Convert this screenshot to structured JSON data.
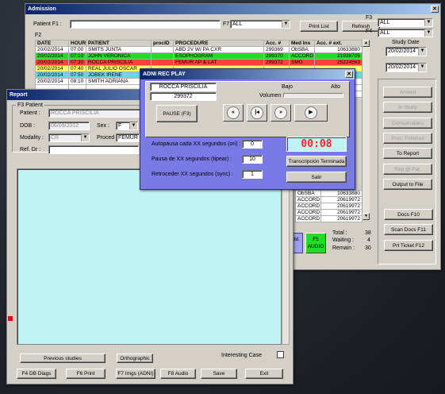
{
  "admission": {
    "title": "Admission",
    "patient_label": "Patient F1 :",
    "f7_label": "F7",
    "f7_value": "ALL",
    "f2_label": "F2",
    "print_list": "Print List",
    "refresh": "Refresh",
    "f3_label": "F3",
    "f3_value": "ALL",
    "f4_label": "F4",
    "f4_value": "ALL",
    "study_date_label": "Study Date",
    "date_from": "20/02/2014",
    "date_to": "20/02/2014",
    "columns": [
      "DATE",
      "HOUR",
      "PATIENT",
      "procID",
      "PROCEDURE",
      "Acc. #",
      "Med Ins",
      "Acc. # ext."
    ],
    "rows": [
      {
        "date": "20/02/2014",
        "hour": "07:00",
        "patient": "SMITS JUNTA",
        "procid": "",
        "procedure": "ABD 2V W/ PA CXR",
        "acc": "299369",
        "medins": "ObSBA",
        "accext": "10633880"
      },
      {
        "date": "20/02/2014",
        "hour": "07:10",
        "patient": "JOHN VERONICA",
        "procid": "",
        "procedure": "ESOPHOGRAM",
        "acc": "299370",
        "medins": "ACCORD",
        "accext": "21938705"
      },
      {
        "date": "20/02/2014",
        "hour": "07:30",
        "patient": "ROCCA PRISCILIA",
        "procid": "",
        "procedure": "FEMUR AP & LAT",
        "acc": "299372",
        "medins": "SMG",
        "accext": "25224563"
      },
      {
        "date": "20/02/2014",
        "hour": "07:40",
        "patient": "REAL JULIO OSCAR",
        "procid": "",
        "procedure": "",
        "acc": "",
        "medins": "",
        "accext": ""
      },
      {
        "date": "20/02/2014",
        "hour": "07:50",
        "patient": "JOBEK IRENE",
        "procid": "",
        "procedure": "",
        "acc": "",
        "medins": "",
        "accext": ""
      },
      {
        "date": "20/02/2014",
        "hour": "08:10",
        "patient": "SMITH ADRIANA",
        "procid": "",
        "procedure": "",
        "acc": "",
        "medins": "",
        "accext": ""
      }
    ],
    "lower_rows": [
      {
        "medins": "ObSBA",
        "accext": "10633880"
      },
      {
        "medins": "ACCORD",
        "accext": "20619972"
      },
      {
        "medins": "ACCORD",
        "accext": "20619972"
      },
      {
        "medins": "ACCORD",
        "accext": "20619972"
      },
      {
        "medins": "ACCORD",
        "accext": "20619972"
      }
    ],
    "side_buttons": [
      "Arrived",
      "In Study",
      "Consumables",
      "Proc. Finished",
      "To Report",
      "Rep @ Pat.",
      "Output to File"
    ],
    "docs_f10": "Docs F10",
    "scan_docs": "Scan Docs F11",
    "prt_ticket": "Prt Ticket F12",
    "total_label": "Total :",
    "total_value": "38",
    "waiting_label": "Waiting :",
    "waiting_value": "4",
    "remain_label": "Remain :",
    "remain_value": "30",
    "f5_audio_line1": "F5",
    "f5_audio_line2": "AUDIO",
    "add_partial": "dd."
  },
  "report": {
    "title": "Report",
    "group_label": "F3 Patient",
    "patient_label": "Patient :",
    "patient_value": "ROCCA PRISCILIA",
    "dob_label": "DOB :",
    "dob_value": "06/09/2012",
    "sex_label": "Sex :",
    "sex_value": "F",
    "modality_label": "Modality :",
    "modality_value": "CR",
    "proced_label": "Proced :",
    "proced_value": "FEMUR AP",
    "refdr_label": "Ref. Dr :",
    "interesting_case": "Interesting Case",
    "previous_studies": "Previous studies",
    "orthographic": "Orthographic",
    "f4_db_diags": "F4 DB Diags",
    "f6_print": "F6 Print",
    "f7_imgs": "F7 Imgs (ADNI)",
    "f8_audio": "F8 Audio",
    "save": "Save",
    "exit": "Exit"
  },
  "player": {
    "title": "ADNI REC PLAY",
    "patient_name": "ROCCA PRISCILIA",
    "acc_number": "299372",
    "bajo": "Bajo",
    "alto": "Alto",
    "volumen": "Volumen",
    "pause_btn": "PAUSE (F3)",
    "autopausa_label": "Autopausa cada XX segundos (on) :",
    "autopausa_value": "0",
    "pausa_label": "Pausa de XX segundos (tipear) :",
    "pausa_value": "10",
    "retroceder_label": "Retroceder XX segundos (sync) :",
    "retroceder_value": "1",
    "timer": "00:08",
    "transcripcion": "Transcripción Terminada",
    "salir": "Salir"
  },
  "colors": {
    "title_start": "#0a246a",
    "title_end": "#a6caf0",
    "player_bg": "#7a7ae6",
    "report_text_bg": "#bff4f6",
    "timer_text": "#ff2020",
    "timer_bg": "#bff4f6"
  }
}
